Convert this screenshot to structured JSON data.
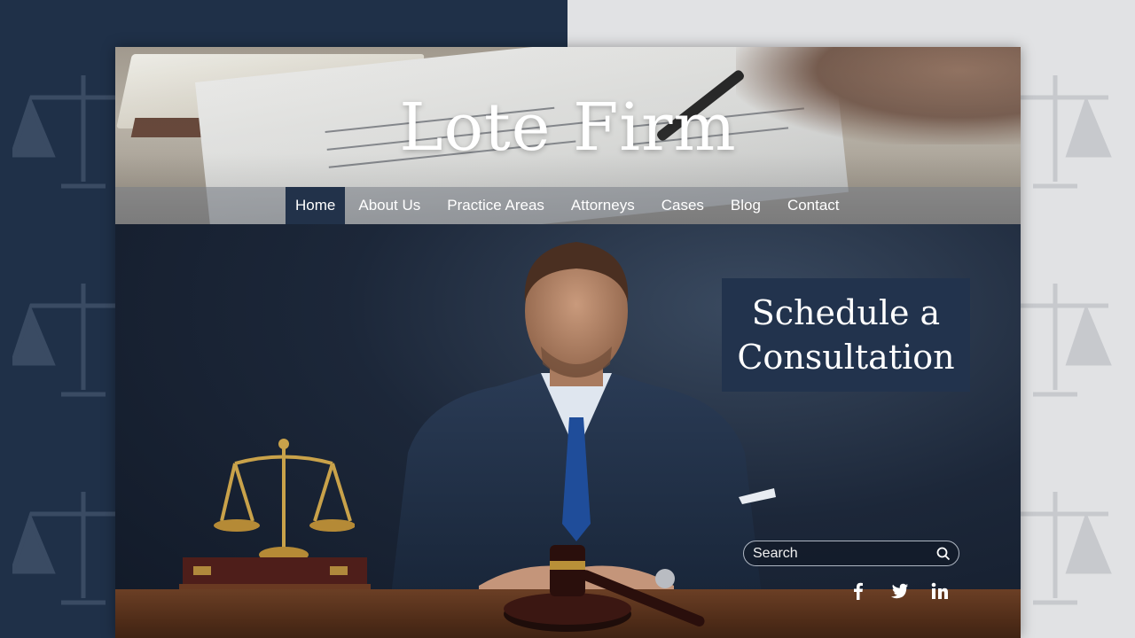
{
  "brand": {
    "name": "Lote Firm"
  },
  "nav": {
    "items": [
      {
        "label": "Home",
        "active": true
      },
      {
        "label": "About Us",
        "active": false
      },
      {
        "label": "Practice Areas",
        "active": false
      },
      {
        "label": "Attorneys",
        "active": false
      },
      {
        "label": "Cases",
        "active": false
      },
      {
        "label": "Blog",
        "active": false
      },
      {
        "label": "Contact",
        "active": false
      }
    ]
  },
  "hero": {
    "cta_line1": "Schedule a",
    "cta_line2": "Consultation"
  },
  "search": {
    "placeholder": "Search",
    "icon": "search-icon"
  },
  "social": {
    "icons": [
      "facebook-icon",
      "twitter-icon",
      "linkedin-icon"
    ]
  },
  "colors": {
    "navy": "#22334d",
    "backdrop_left": "#1f3048",
    "backdrop_right": "#e1e2e4",
    "text": "#ffffff"
  }
}
